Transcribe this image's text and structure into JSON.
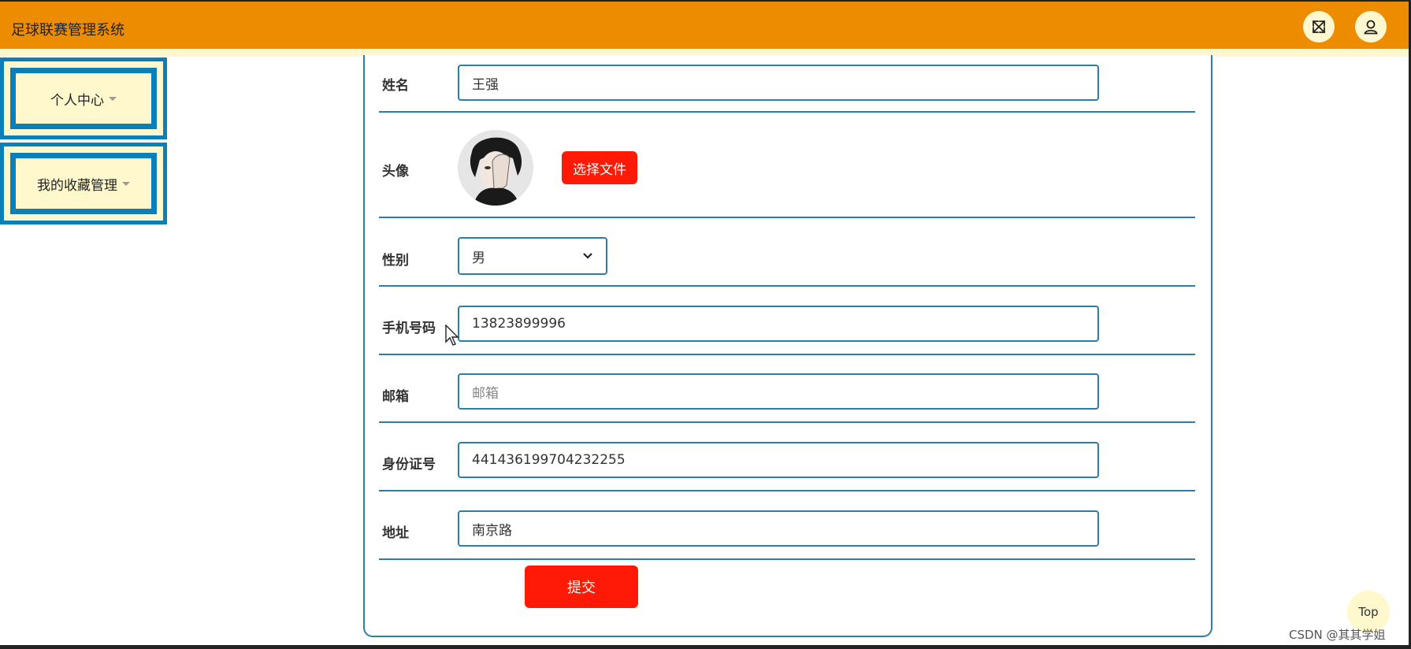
{
  "header": {
    "app_title": "足球联赛管理系统",
    "fullscreen_icon": "expand-arrows-icon",
    "user_icon": "user-icon"
  },
  "sidebar": {
    "items": [
      {
        "label": "个人中心"
      },
      {
        "label": "我的收藏管理"
      }
    ]
  },
  "form": {
    "name": {
      "label": "姓名",
      "value": "王强"
    },
    "avatar": {
      "label": "头像",
      "button": "选择文件"
    },
    "gender": {
      "label": "性别",
      "value": "男"
    },
    "phone": {
      "label": "手机号码",
      "value": "13823899996"
    },
    "email": {
      "label": "邮箱",
      "placeholder": "邮箱"
    },
    "idcard": {
      "label": "身份证号",
      "value": "441436199704232255"
    },
    "address": {
      "label": "地址",
      "value": "南京路"
    },
    "submit": "提交"
  },
  "top_button": "Top",
  "watermark": "CSDN @其其学姐",
  "colors": {
    "header": "#ee8c00",
    "sidebar_bg": "#fff8cc",
    "sidebar_border": "#0b7fb8",
    "form_border": "#2a7fa8",
    "button_red": "#ff1a08"
  }
}
